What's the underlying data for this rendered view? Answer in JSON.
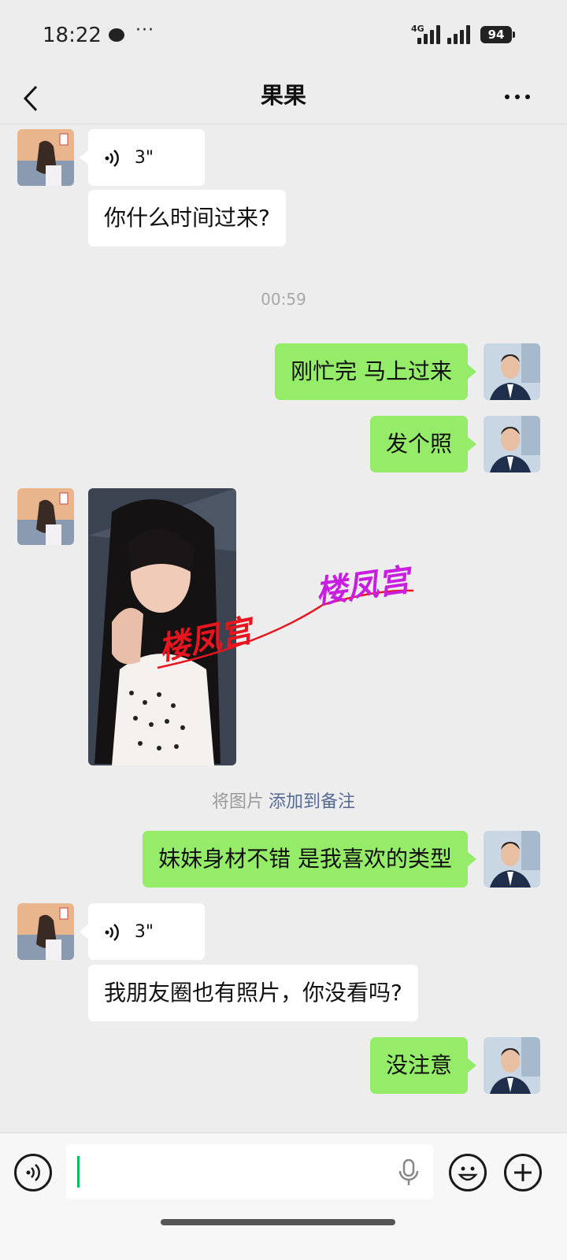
{
  "status_bar": {
    "time": "18:22",
    "dots": "···",
    "network": "4G",
    "battery": "94"
  },
  "header": {
    "title": "果果"
  },
  "messages": [
    {
      "side": "in",
      "type": "voice",
      "duration": "3\""
    },
    {
      "side": "in",
      "type": "text",
      "text": "你什么时间过来?"
    },
    {
      "type": "timestamp",
      "text": "00:59"
    },
    {
      "side": "out",
      "type": "text",
      "text": "刚忙完 马上过来"
    },
    {
      "side": "out",
      "type": "text",
      "text": "发个照"
    },
    {
      "side": "in",
      "type": "image",
      "watermark": "楼凤宫"
    },
    {
      "type": "note",
      "prefix": "将图片",
      "link": "添加到备注"
    },
    {
      "side": "out",
      "type": "text",
      "text": "妹妹身材不错 是我喜欢的类型"
    },
    {
      "side": "in",
      "type": "voice",
      "duration": "3\""
    },
    {
      "side": "in",
      "type": "text",
      "text": "我朋友圈也有照片，你没看吗?"
    },
    {
      "side": "out",
      "type": "text",
      "text": "没注意"
    }
  ],
  "watermark_overlay": {
    "text": "楼凤宫"
  },
  "icons": {
    "back": "chevron-left-icon",
    "more": "more-dots-icon",
    "voice_mode": "voice-icon",
    "mic": "microphone-icon",
    "emoji": "emoji-icon",
    "plus": "plus-icon"
  },
  "colors": {
    "background": "#ededed",
    "outgoing_bubble": "#95ec69",
    "incoming_bubble": "#ffffff",
    "link": "#576b95",
    "caret": "#07c160",
    "watermark_red": "#e8141e",
    "watermark_magenta": "#c81ee0"
  }
}
